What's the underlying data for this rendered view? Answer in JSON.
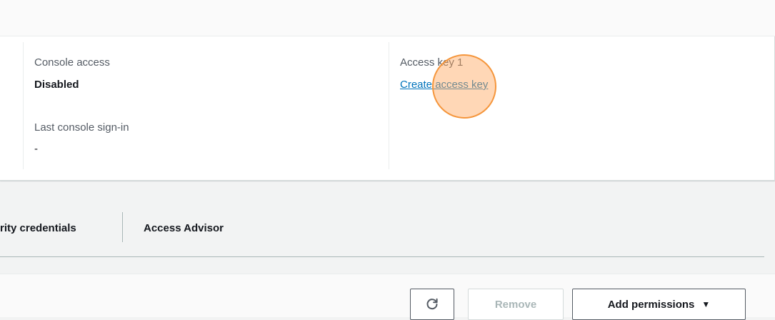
{
  "summary": {
    "console_access_label": "Console access",
    "console_access_value": "Disabled",
    "last_signin_label": "Last console sign-in",
    "last_signin_value": "-",
    "access_key_label": "Access key 1",
    "create_access_key_link": "Create access key"
  },
  "tabs": [
    {
      "label": "rity credentials"
    },
    {
      "label": "Access Advisor"
    }
  ],
  "toolbar": {
    "refresh_icon": "refresh-icon",
    "remove_label": "Remove",
    "add_permissions_label": "Add permissions",
    "add_permissions_caret": "▼"
  },
  "colors": {
    "link": "#0073bb",
    "highlight": "#f5963c"
  }
}
